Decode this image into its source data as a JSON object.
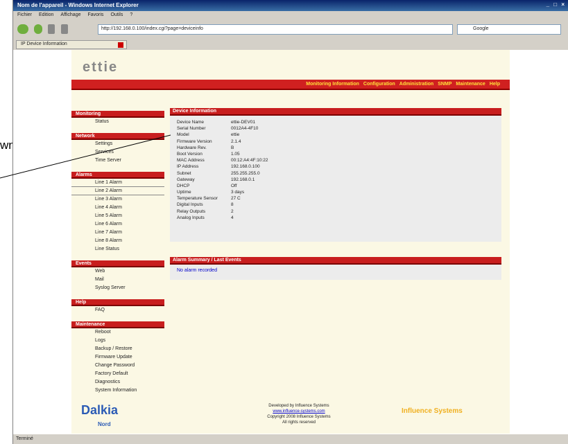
{
  "browser": {
    "title": "Nom de l'appareil - Windows Internet Explorer",
    "menu": [
      "Fichier",
      "Edition",
      "Affichage",
      "Favoris",
      "Outils",
      "?"
    ],
    "address": "http://192.168.0.100/index.cgi?page=deviceinfo",
    "search_placeholder": "Google",
    "tab_label": "IP Device Information",
    "status": "Terminé"
  },
  "annotation": {
    "text": "wn”"
  },
  "page": {
    "logo": "ettie",
    "topnav": [
      "Monitoring Information",
      "Configuration",
      "Administration",
      "SNMP",
      "Maintenance",
      "Help"
    ],
    "sidebar": [
      {
        "head": "Monitoring",
        "items": [
          "Status"
        ]
      },
      {
        "head": "Network",
        "items": [
          "Settings",
          "Services",
          "Time Server"
        ]
      },
      {
        "head": "Alarms",
        "items": [
          "Line 1 Alarm",
          "Line 2 Alarm",
          "Line 3 Alarm",
          "Line 4 Alarm",
          "Line 5 Alarm",
          "Line 6 Alarm",
          "Line 7 Alarm",
          "Line 8 Alarm",
          "Line Status"
        ]
      },
      {
        "head": "Events",
        "items": [
          "Web",
          "Mail",
          "Syslog Server"
        ]
      },
      {
        "head": "Help",
        "items": [
          "FAQ"
        ]
      },
      {
        "head": "Maintenance",
        "items": [
          "Reboot",
          "Logs",
          "Backup / Restore",
          "Firmware Update",
          "Change Password",
          "Factory Default",
          "Diagnostics",
          "System Information"
        ]
      }
    ],
    "device_panel": {
      "title": "Device Information",
      "rows": [
        [
          "Device Name",
          "ettie-DEV01"
        ],
        [
          "Serial Number",
          "0012A4-4F10"
        ],
        [
          "Model",
          "ettie"
        ],
        [
          "Firmware Version",
          "2.1.4"
        ],
        [
          "Hardware Rev.",
          "B"
        ],
        [
          "Boot Version",
          "1.05"
        ],
        [
          "MAC Address",
          "00:12:A4:4F:10:22"
        ],
        [
          "IP Address",
          "192.168.0.100"
        ],
        [
          "Subnet",
          "255.255.255.0"
        ],
        [
          "Gateway",
          "192.168.0.1"
        ],
        [
          "DHCP",
          "Off"
        ],
        [
          "Uptime",
          "3 days"
        ],
        [
          "Temperature Sensor",
          "27 C"
        ],
        [
          "Digital Inputs",
          "8"
        ],
        [
          "Relay Outputs",
          "2"
        ],
        [
          "Analog Inputs",
          "4"
        ]
      ]
    },
    "alarm_panel": {
      "title": "Alarm Summary / Last Events",
      "link": "No alarm recorded"
    },
    "footer": {
      "brand": "Dalkia",
      "brand_sub": "Nord",
      "text_lines": [
        "Developed by Influence Systems",
        "Copyright 2008 Influence Systems",
        "All rights reserved"
      ],
      "link": "www.influence-systems.com",
      "partner": "Influence Systems"
    }
  }
}
